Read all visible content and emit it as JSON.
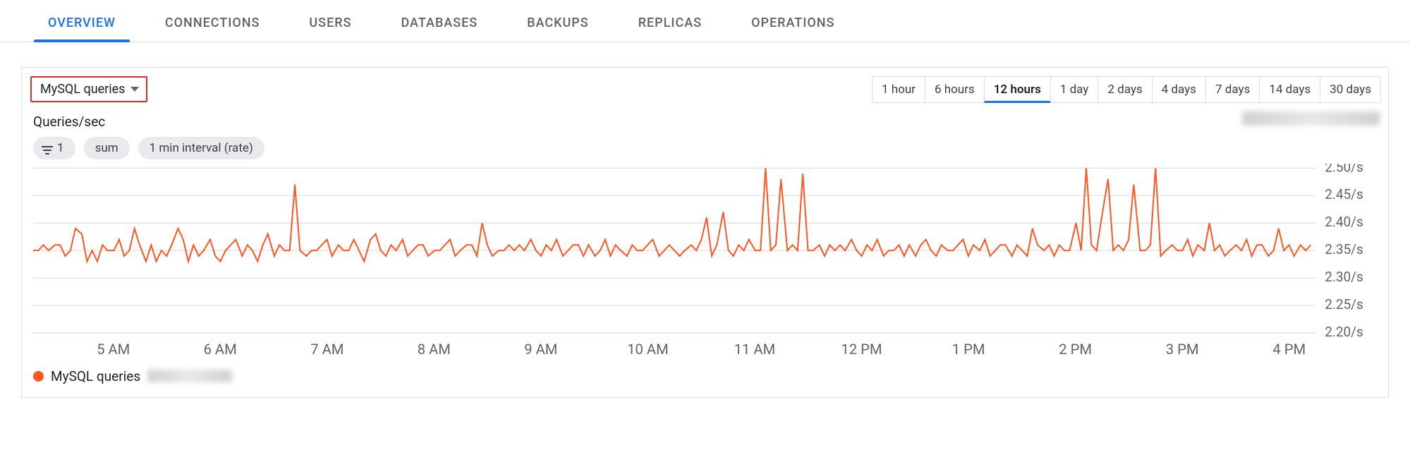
{
  "tabs": [
    "OVERVIEW",
    "CONNECTIONS",
    "USERS",
    "DATABASES",
    "BACKUPS",
    "REPLICAS",
    "OPERATIONS"
  ],
  "active_tab": 0,
  "metric_selector": {
    "label": "MySQL queries"
  },
  "time_ranges": [
    "1 hour",
    "6 hours",
    "12 hours",
    "1 day",
    "2 days",
    "4 days",
    "7 days",
    "14 days",
    "30 days"
  ],
  "selected_range": 2,
  "y_axis_title": "Queries/sec",
  "chips": {
    "filter_count": "1",
    "agg": "sum",
    "interval": "1 min interval (rate)"
  },
  "legend": {
    "color": "#ff5722",
    "label": "MySQL queries"
  },
  "chart_data": {
    "type": "line",
    "title": "Queries/sec",
    "xlabel": "",
    "ylabel": "Queries/sec",
    "ylim": [
      2.2,
      2.5
    ],
    "y_ticks": [
      "2.50/s",
      "2.45/s",
      "2.40/s",
      "2.35/s",
      "2.30/s",
      "2.25/s",
      "2.20/s"
    ],
    "y_tick_values": [
      2.5,
      2.45,
      2.4,
      2.35,
      2.3,
      2.25,
      2.2
    ],
    "x_tick_labels": [
      "5 AM",
      "6 AM",
      "7 AM",
      "8 AM",
      "9 AM",
      "10 AM",
      "11 AM",
      "12 PM",
      "1 PM",
      "2 PM",
      "3 PM",
      "4 PM"
    ],
    "x_tick_fractions": [
      0.0625,
      0.1458,
      0.2292,
      0.3125,
      0.3958,
      0.4792,
      0.5625,
      0.6458,
      0.7292,
      0.8125,
      0.8958,
      0.9792
    ],
    "series": [
      {
        "name": "MySQL queries",
        "color": "#ff5722",
        "x_fractions": [
          0.0,
          0.004,
          0.008,
          0.012,
          0.017,
          0.021,
          0.025,
          0.029,
          0.033,
          0.038,
          0.042,
          0.046,
          0.05,
          0.054,
          0.058,
          0.063,
          0.067,
          0.071,
          0.075,
          0.079,
          0.083,
          0.088,
          0.092,
          0.096,
          0.1,
          0.104,
          0.108,
          0.113,
          0.117,
          0.121,
          0.125,
          0.129,
          0.133,
          0.138,
          0.142,
          0.146,
          0.15,
          0.154,
          0.158,
          0.163,
          0.167,
          0.171,
          0.175,
          0.179,
          0.183,
          0.188,
          0.192,
          0.196,
          0.2,
          0.204,
          0.208,
          0.213,
          0.217,
          0.221,
          0.225,
          0.229,
          0.233,
          0.238,
          0.242,
          0.246,
          0.25,
          0.254,
          0.258,
          0.263,
          0.267,
          0.271,
          0.275,
          0.279,
          0.283,
          0.288,
          0.292,
          0.296,
          0.3,
          0.304,
          0.308,
          0.313,
          0.317,
          0.321,
          0.325,
          0.329,
          0.333,
          0.338,
          0.342,
          0.346,
          0.35,
          0.354,
          0.358,
          0.363,
          0.367,
          0.371,
          0.375,
          0.379,
          0.383,
          0.388,
          0.392,
          0.396,
          0.4,
          0.404,
          0.408,
          0.413,
          0.417,
          0.421,
          0.425,
          0.429,
          0.433,
          0.438,
          0.442,
          0.446,
          0.45,
          0.454,
          0.458,
          0.463,
          0.467,
          0.471,
          0.475,
          0.479,
          0.483,
          0.488,
          0.492,
          0.496,
          0.5,
          0.504,
          0.508,
          0.513,
          0.517,
          0.521,
          0.525,
          0.529,
          0.533,
          0.538,
          0.542,
          0.546,
          0.55,
          0.554,
          0.558,
          0.563,
          0.567,
          0.571,
          0.575,
          0.579,
          0.583,
          0.588,
          0.592,
          0.596,
          0.6,
          0.604,
          0.608,
          0.613,
          0.617,
          0.621,
          0.625,
          0.629,
          0.633,
          0.638,
          0.642,
          0.646,
          0.65,
          0.654,
          0.658,
          0.663,
          0.667,
          0.671,
          0.675,
          0.679,
          0.683,
          0.688,
          0.692,
          0.696,
          0.7,
          0.704,
          0.708,
          0.713,
          0.717,
          0.721,
          0.725,
          0.729,
          0.733,
          0.738,
          0.742,
          0.746,
          0.75,
          0.754,
          0.758,
          0.763,
          0.767,
          0.771,
          0.775,
          0.779,
          0.783,
          0.788,
          0.792,
          0.796,
          0.8,
          0.804,
          0.808,
          0.813,
          0.817,
          0.821,
          0.825,
          0.829,
          0.833,
          0.838,
          0.842,
          0.846,
          0.85,
          0.854,
          0.858,
          0.863,
          0.867,
          0.871,
          0.875,
          0.879,
          0.883,
          0.888,
          0.892,
          0.896,
          0.9,
          0.904,
          0.908,
          0.913,
          0.917,
          0.921,
          0.925,
          0.929,
          0.933,
          0.938,
          0.942,
          0.946,
          0.95,
          0.954,
          0.958,
          0.963,
          0.967,
          0.971,
          0.975,
          0.979,
          0.983,
          0.988,
          0.992,
          0.996
        ],
        "values": [
          2.35,
          2.35,
          2.36,
          2.35,
          2.36,
          2.36,
          2.34,
          2.35,
          2.39,
          2.38,
          2.33,
          2.35,
          2.33,
          2.36,
          2.35,
          2.35,
          2.37,
          2.34,
          2.35,
          2.39,
          2.36,
          2.33,
          2.36,
          2.33,
          2.35,
          2.34,
          2.36,
          2.39,
          2.37,
          2.33,
          2.36,
          2.34,
          2.35,
          2.37,
          2.34,
          2.33,
          2.35,
          2.36,
          2.37,
          2.34,
          2.36,
          2.35,
          2.33,
          2.36,
          2.38,
          2.34,
          2.36,
          2.35,
          2.35,
          2.47,
          2.35,
          2.34,
          2.35,
          2.35,
          2.36,
          2.37,
          2.34,
          2.36,
          2.35,
          2.35,
          2.37,
          2.35,
          2.33,
          2.37,
          2.38,
          2.35,
          2.34,
          2.36,
          2.35,
          2.37,
          2.34,
          2.35,
          2.36,
          2.36,
          2.34,
          2.35,
          2.35,
          2.36,
          2.37,
          2.34,
          2.35,
          2.36,
          2.36,
          2.34,
          2.4,
          2.36,
          2.34,
          2.35,
          2.35,
          2.36,
          2.35,
          2.36,
          2.35,
          2.37,
          2.35,
          2.34,
          2.36,
          2.35,
          2.37,
          2.34,
          2.35,
          2.36,
          2.36,
          2.34,
          2.36,
          2.34,
          2.35,
          2.37,
          2.34,
          2.36,
          2.35,
          2.34,
          2.36,
          2.35,
          2.35,
          2.36,
          2.37,
          2.34,
          2.35,
          2.36,
          2.35,
          2.34,
          2.35,
          2.36,
          2.35,
          2.37,
          2.41,
          2.34,
          2.36,
          2.42,
          2.35,
          2.34,
          2.36,
          2.35,
          2.37,
          2.35,
          2.35,
          2.52,
          2.35,
          2.36,
          2.48,
          2.35,
          2.36,
          2.35,
          2.49,
          2.35,
          2.35,
          2.36,
          2.34,
          2.36,
          2.35,
          2.36,
          2.35,
          2.37,
          2.35,
          2.34,
          2.36,
          2.35,
          2.37,
          2.34,
          2.35,
          2.35,
          2.36,
          2.34,
          2.36,
          2.34,
          2.36,
          2.37,
          2.35,
          2.34,
          2.36,
          2.35,
          2.35,
          2.36,
          2.37,
          2.34,
          2.36,
          2.35,
          2.37,
          2.34,
          2.35,
          2.36,
          2.36,
          2.34,
          2.36,
          2.35,
          2.34,
          2.39,
          2.36,
          2.35,
          2.36,
          2.34,
          2.36,
          2.35,
          2.35,
          2.4,
          2.35,
          2.52,
          2.36,
          2.35,
          2.41,
          2.48,
          2.35,
          2.36,
          2.35,
          2.37,
          2.47,
          2.35,
          2.35,
          2.36,
          2.53,
          2.34,
          2.35,
          2.36,
          2.35,
          2.35,
          2.37,
          2.34,
          2.36,
          2.35,
          2.4,
          2.35,
          2.36,
          2.34,
          2.35,
          2.36,
          2.35,
          2.37,
          2.34,
          2.36,
          2.36,
          2.34,
          2.35,
          2.39,
          2.35,
          2.36,
          2.34,
          2.36,
          2.35,
          2.36
        ]
      }
    ]
  }
}
